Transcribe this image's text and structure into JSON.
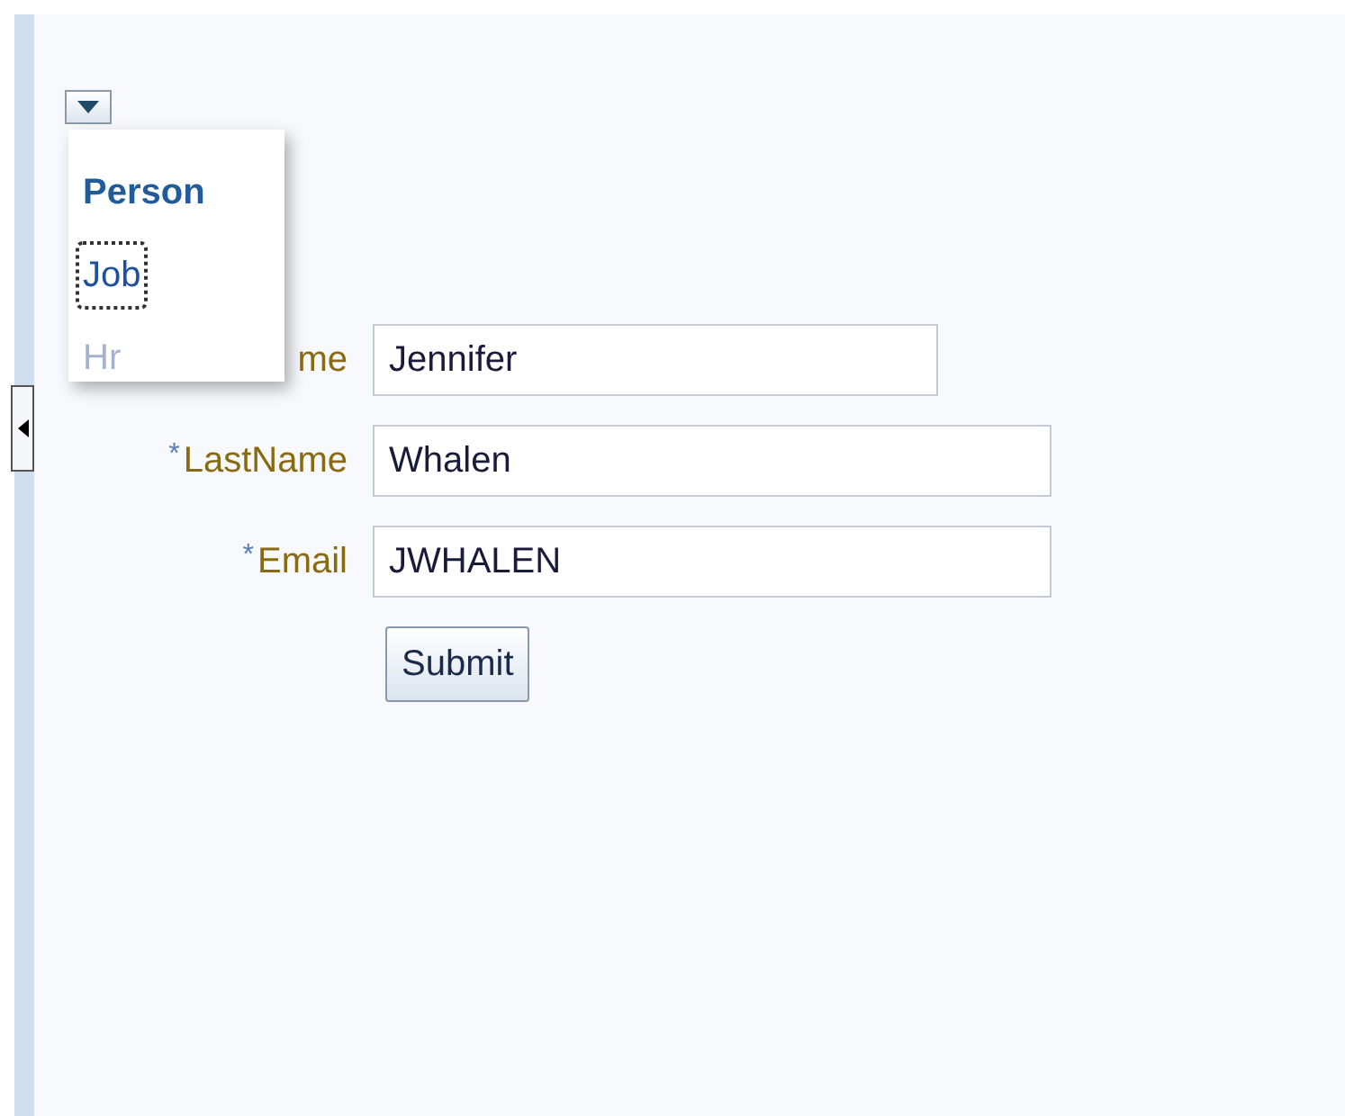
{
  "menu": {
    "expanded": true,
    "items": [
      {
        "label": "Person",
        "current": true,
        "focused": false,
        "disabled": false
      },
      {
        "label": "Job",
        "current": false,
        "focused": true,
        "disabled": false
      },
      {
        "label": "Hr",
        "current": false,
        "focused": false,
        "disabled": true
      }
    ]
  },
  "form": {
    "fields": [
      {
        "label": "me",
        "required": false,
        "value": "Jennifer",
        "wide": false
      },
      {
        "label": "LastName",
        "required": true,
        "value": "Whalen",
        "wide": true
      },
      {
        "label": "Email",
        "required": true,
        "value": "JWHALEN",
        "wide": true
      }
    ],
    "required_mark": "*",
    "submit": "Submit"
  }
}
